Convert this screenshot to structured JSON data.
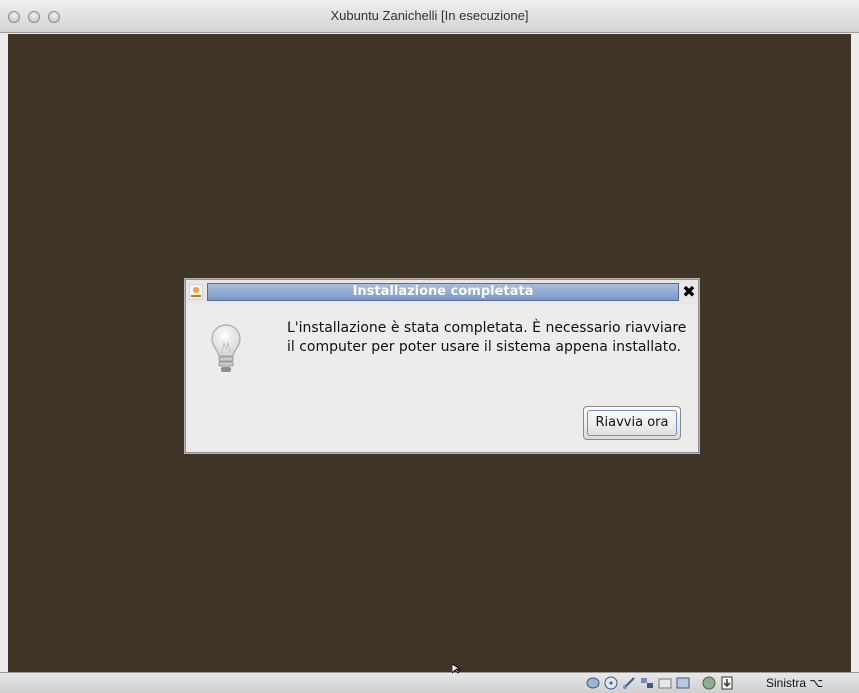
{
  "window": {
    "title": "Xubuntu Zanichelli [In esecuzione]"
  },
  "dialog": {
    "title": "Installazione completata",
    "message": "L'installazione è stata completata. È necessario riavviare il computer per poter usare il sistema appena installato.",
    "restart_button": "Riavvia ora",
    "close_glyph": "✖",
    "icon": "lightbulb-icon"
  },
  "statusbar": {
    "host_key": "Sinistra ⌥",
    "icons": [
      "hard-disk-icon",
      "cd-icon",
      "usb-icon",
      "network-icon",
      "shared-folder-icon",
      "display-icon",
      "capture-icon",
      "mouse-integration-icon"
    ]
  },
  "colors": {
    "desktop_bg": "#3f3426",
    "title_gradient_top": "#a9bfdf",
    "title_gradient_bottom": "#7c97c5"
  }
}
